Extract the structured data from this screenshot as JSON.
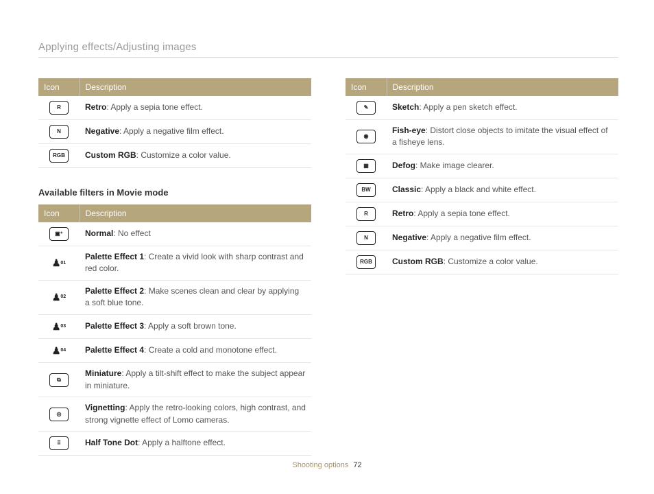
{
  "header": {
    "title": "Applying effects/Adjusting images"
  },
  "tableHeaders": {
    "icon": "Icon",
    "description": "Description"
  },
  "table1": {
    "rows": [
      {
        "icon": "R",
        "iconKind": "box",
        "name": "Retro",
        "desc": ": Apply a sepia tone effect."
      },
      {
        "icon": "N",
        "iconKind": "box",
        "name": "Negative",
        "desc": ": Apply a negative film effect."
      },
      {
        "icon": "RGB",
        "iconKind": "box",
        "name": "Custom RGB",
        "desc": ": Customize a color value."
      }
    ]
  },
  "subheading1": "Available filters in Movie mode",
  "table2": {
    "rows": [
      {
        "icon": "▣⁺",
        "iconKind": "box",
        "name": "Normal",
        "desc": ": No effect"
      },
      {
        "icon": "01",
        "iconKind": "palette",
        "name": "Palette Effect 1",
        "desc": ": Create a vivid look with sharp contrast and red color."
      },
      {
        "icon": "02",
        "iconKind": "palette",
        "name": "Palette Effect 2",
        "desc": ": Make scenes clean and clear by applying a soft blue tone."
      },
      {
        "icon": "03",
        "iconKind": "palette",
        "name": "Palette Effect 3",
        "desc": ": Apply a soft brown tone."
      },
      {
        "icon": "04",
        "iconKind": "palette",
        "name": "Palette Effect 4",
        "desc": ": Create a cold and monotone effect."
      },
      {
        "icon": "⧉",
        "iconKind": "box",
        "name": "Miniature",
        "desc": ": Apply a tilt-shift effect to make the subject appear in miniature."
      },
      {
        "icon": "◎",
        "iconKind": "box",
        "name": "Vignetting",
        "desc": ": Apply the retro-looking colors, high contrast, and strong vignette effect of Lomo cameras."
      },
      {
        "icon": "⠿",
        "iconKind": "box",
        "name": "Half Tone Dot",
        "desc": ": Apply a halftone effect."
      }
    ]
  },
  "table3": {
    "rows": [
      {
        "icon": "✎",
        "iconKind": "box",
        "name": "Sketch",
        "desc": ": Apply a pen sketch effect."
      },
      {
        "icon": "◉",
        "iconKind": "box",
        "name": "Fish-eye",
        "desc": ": Distort close objects to imitate the visual effect of a fisheye lens."
      },
      {
        "icon": "▦",
        "iconKind": "box",
        "name": "Defog",
        "desc": ": Make image clearer."
      },
      {
        "icon": "BW",
        "iconKind": "box",
        "name": "Classic",
        "desc": ": Apply a black and white effect."
      },
      {
        "icon": "R",
        "iconKind": "box",
        "name": "Retro",
        "desc": ": Apply a sepia tone effect."
      },
      {
        "icon": "N",
        "iconKind": "box",
        "name": "Negative",
        "desc": ": Apply a negative film effect."
      },
      {
        "icon": "RGB",
        "iconKind": "box",
        "name": "Custom RGB",
        "desc": ": Customize a color value."
      }
    ]
  },
  "footer": {
    "section": "Shooting options",
    "page": "72"
  }
}
